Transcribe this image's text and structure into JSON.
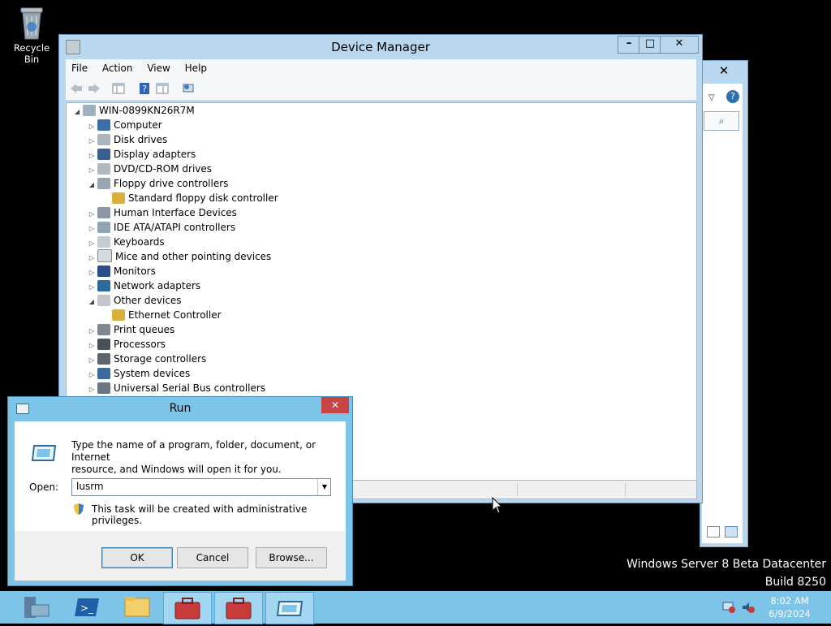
{
  "desktop": {
    "recycle_bin_label": "Recycle Bin"
  },
  "device_manager": {
    "title": "Device Manager",
    "menu": [
      "File",
      "Action",
      "View",
      "Help"
    ],
    "tree": {
      "root": "WIN-0899KN26R7M",
      "items": [
        {
          "label": "Computer",
          "expanded": false,
          "icon": "computer-icon"
        },
        {
          "label": "Disk drives",
          "expanded": false,
          "icon": "disk-drive-icon"
        },
        {
          "label": "Display adapters",
          "expanded": false,
          "icon": "display-adapter-icon"
        },
        {
          "label": "DVD/CD-ROM drives",
          "expanded": false,
          "icon": "dvd-drive-icon"
        },
        {
          "label": "Floppy drive controllers",
          "expanded": true,
          "icon": "floppy-controller-icon",
          "children": [
            {
              "label": "Standard floppy disk controller",
              "icon": "warning-device-icon"
            }
          ]
        },
        {
          "label": "Human Interface Devices",
          "expanded": false,
          "icon": "hid-icon"
        },
        {
          "label": "IDE ATA/ATAPI controllers",
          "expanded": false,
          "icon": "ide-controller-icon"
        },
        {
          "label": "Keyboards",
          "expanded": false,
          "icon": "keyboard-icon"
        },
        {
          "label": "Mice and other pointing devices",
          "expanded": false,
          "icon": "mouse-icon"
        },
        {
          "label": "Monitors",
          "expanded": false,
          "icon": "monitor-icon"
        },
        {
          "label": "Network adapters",
          "expanded": false,
          "icon": "network-adapter-icon"
        },
        {
          "label": "Other devices",
          "expanded": true,
          "icon": "other-devices-icon",
          "children": [
            {
              "label": "Ethernet Controller",
              "icon": "warning-device-icon"
            }
          ]
        },
        {
          "label": "Print queues",
          "expanded": false,
          "icon": "printer-icon"
        },
        {
          "label": "Processors",
          "expanded": false,
          "icon": "processor-icon"
        },
        {
          "label": "Storage controllers",
          "expanded": false,
          "icon": "storage-controller-icon"
        },
        {
          "label": "System devices",
          "expanded": false,
          "icon": "system-devices-icon"
        },
        {
          "label": "Universal Serial Bus controllers",
          "expanded": false,
          "icon": "usb-icon"
        }
      ]
    }
  },
  "run_dialog": {
    "title": "Run",
    "description": "Type the name of a program, folder, document, or Internet resource, and Windows will open it for you.",
    "description_line1": "Type the name of a program, folder, document, or Internet",
    "description_line2": "resource, and Windows will open it for you.",
    "open_label": "Open:",
    "open_value": "lusrm",
    "admin_note": "This task will be created with administrative privileges.",
    "ok_label": "OK",
    "cancel_label": "Cancel",
    "browse_label": "Browse..."
  },
  "watermark": {
    "line1": "Windows Server 8 Beta Datacenter",
    "line2": "Build 8250"
  },
  "taskbar": {
    "items": [
      "server-manager-icon",
      "powershell-icon",
      "file-explorer-icon",
      "toolbox-icon",
      "toolbox-icon",
      "run-icon"
    ],
    "clock_time": "8:02 AM",
    "clock_date": "6/9/2024"
  },
  "colors": {
    "taskbar": "#7cc4e8",
    "window_frame": "#b9d7ee",
    "close_red": "#c74545"
  }
}
